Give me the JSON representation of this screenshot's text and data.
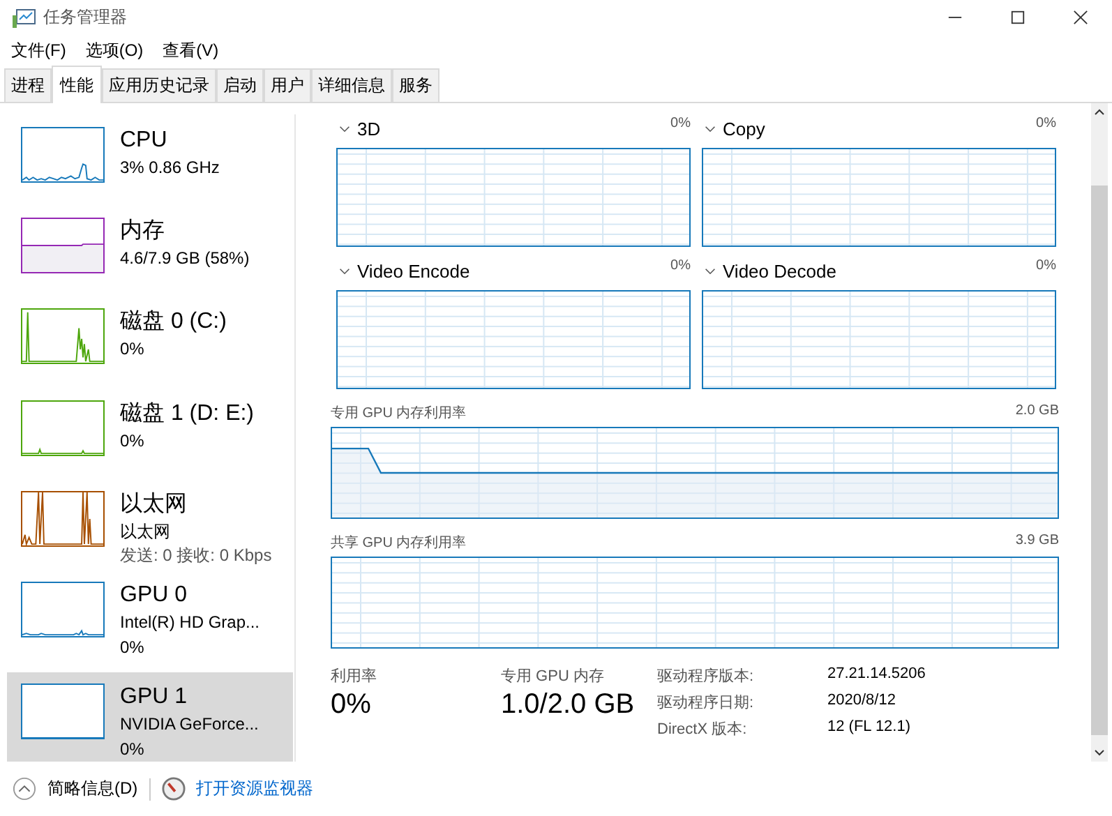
{
  "window": {
    "title": "任务管理器"
  },
  "menu": [
    "文件(F)",
    "选项(O)",
    "查看(V)"
  ],
  "tabs": [
    {
      "label": "进程",
      "selected": false
    },
    {
      "label": "性能",
      "selected": true
    },
    {
      "label": "应用历史记录",
      "selected": false
    },
    {
      "label": "启动",
      "selected": false
    },
    {
      "label": "用户",
      "selected": false
    },
    {
      "label": "详细信息",
      "selected": false
    },
    {
      "label": "服务",
      "selected": false
    }
  ],
  "sidebar": {
    "items": [
      {
        "kind": "cpu",
        "name": "CPU",
        "lines": [
          "3% 0.86 GHz"
        ],
        "color": "#1779ba",
        "selected": false
      },
      {
        "kind": "memory",
        "name": "内存",
        "lines": [
          "4.6/7.9 GB (58%)"
        ],
        "color": "#9528b4",
        "selected": false
      },
      {
        "kind": "disk",
        "name": "磁盘 0 (C:)",
        "lines": [
          "0%"
        ],
        "color": "#4da60c",
        "selected": false
      },
      {
        "kind": "disk_idle",
        "name": "磁盘 1 (D: E:)",
        "lines": [
          "0%"
        ],
        "color": "#4da60c",
        "selected": false
      },
      {
        "kind": "ethernet",
        "name": "以太网",
        "lines": [
          "以太网"
        ],
        "note": "发送: 0 接收: 0 Kbps",
        "color": "#a74f01",
        "selected": false
      },
      {
        "kind": "gpu",
        "name": "GPU 0",
        "lines": [
          "Intel(R) HD Grap...",
          "0%"
        ],
        "color": "#1779ba",
        "selected": false
      },
      {
        "kind": "gpu_idle",
        "name": "GPU 1",
        "lines": [
          "NVIDIA GeForce...",
          "0%"
        ],
        "color": "#1779ba",
        "selected": true
      }
    ]
  },
  "engines": [
    {
      "name": "3D",
      "value": "0%"
    },
    {
      "name": "Copy",
      "value": "0%"
    },
    {
      "name": "Video Encode",
      "value": "0%"
    },
    {
      "name": "Video Decode",
      "value": "0%"
    }
  ],
  "memory_charts": [
    {
      "kind": "dedicated",
      "label": "专用 GPU 内存利用率",
      "max": "2.0 GB"
    },
    {
      "kind": "shared",
      "label": "共享 GPU 内存利用率",
      "max": "3.9 GB"
    }
  ],
  "stats": [
    {
      "label": "利用率",
      "value": "0%"
    },
    {
      "label": "专用 GPU 内存",
      "value": "1.0/2.0 GB"
    }
  ],
  "details": [
    {
      "label": "驱动程序版本:",
      "value": "27.21.14.5206"
    },
    {
      "label": "驱动程序日期:",
      "value": "2020/8/12"
    },
    {
      "label": "DirectX 版本:",
      "value": "12 (FL 12.1)"
    }
  ],
  "footer": {
    "summary": "简略信息(D)",
    "link": "打开资源监视器"
  }
}
